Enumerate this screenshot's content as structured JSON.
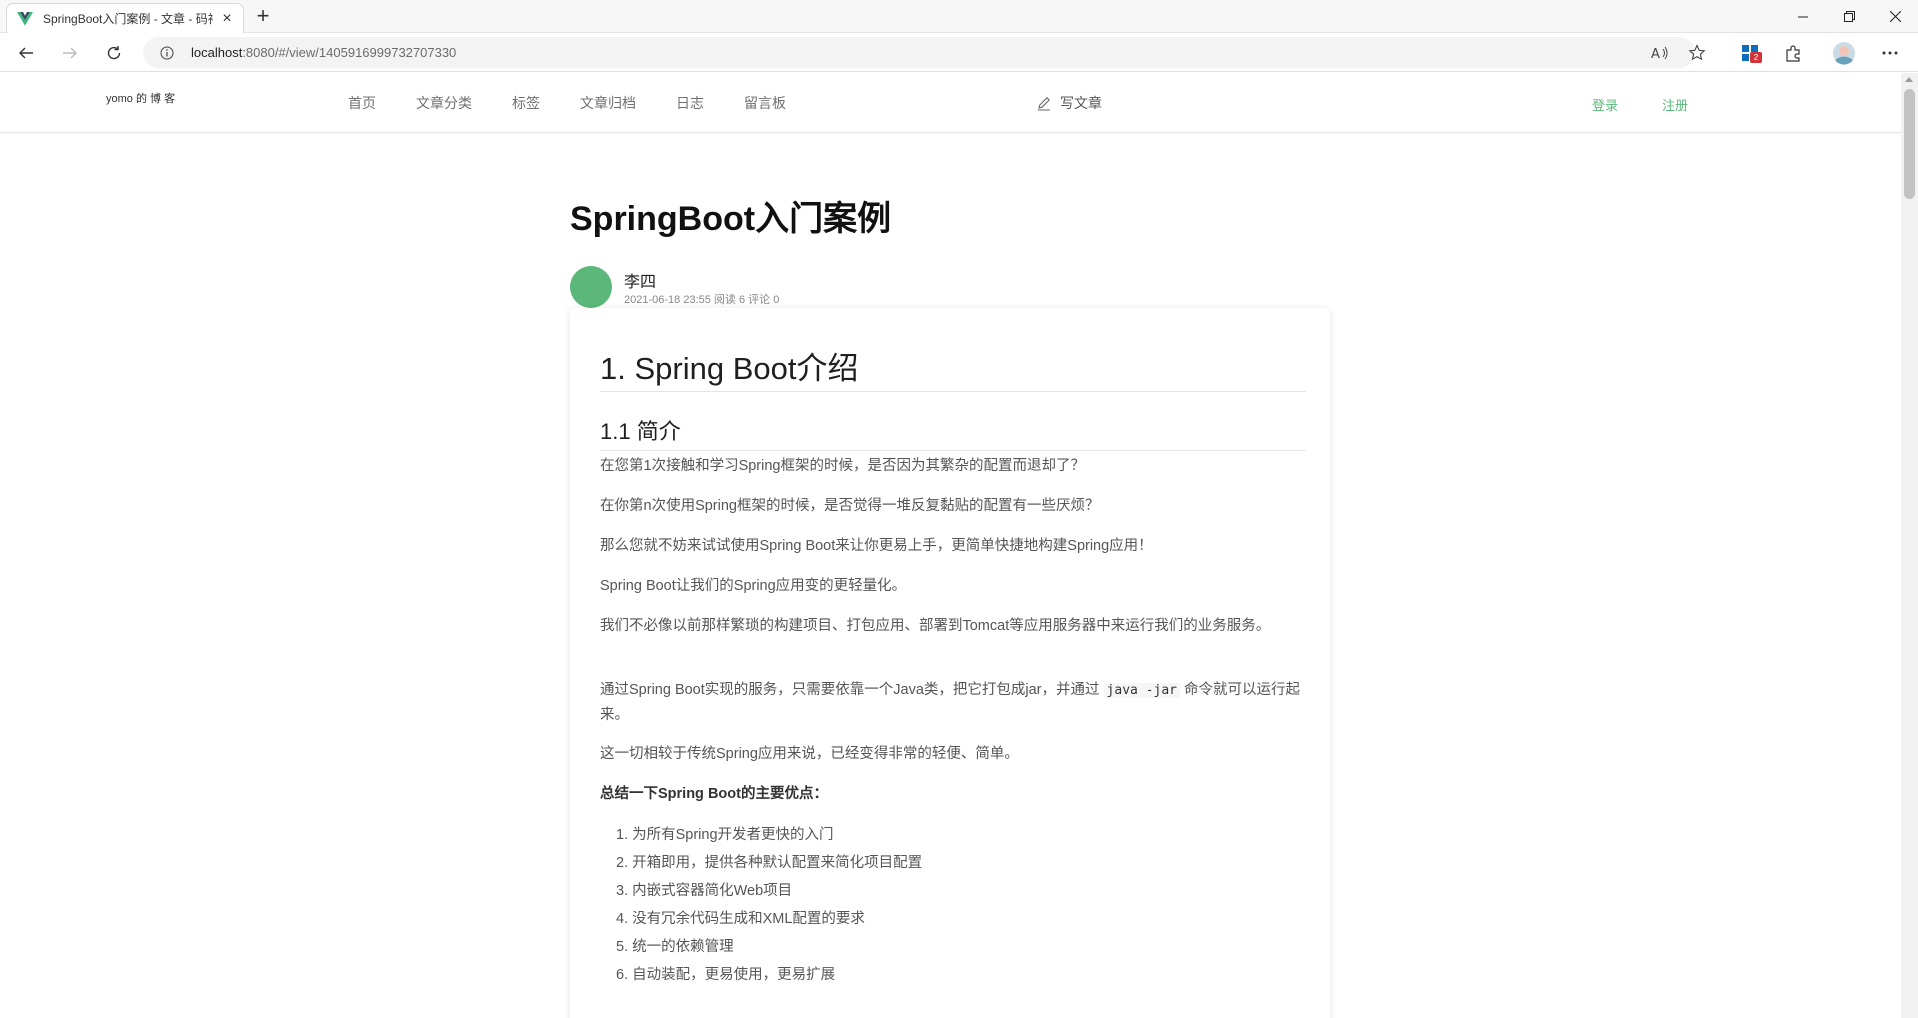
{
  "browser": {
    "tab_title": "SpringBoot入门案例 - 文章 - 码神",
    "url_host": "localhost",
    "url_rest": ":8080/#/view/1405916999732707330",
    "extension_badge": "2"
  },
  "site": {
    "logo": "yomo 的 博 客",
    "nav": [
      "首页",
      "文章分类",
      "标签",
      "文章归档",
      "日志",
      "留言板"
    ],
    "write_label": "写文章",
    "login_label": "登录",
    "register_label": "注册",
    "accent_color": "#5cb87a"
  },
  "article": {
    "title": "SpringBoot入门案例",
    "author": "李四",
    "meta": "2021-06-18 23:55 阅读 6 评论 0",
    "h1": "1. Spring Boot介绍",
    "h2": "1.1 简介",
    "p1": "在您第1次接触和学习Spring框架的时候，是否因为其繁杂的配置而退却了？",
    "p2": "在你第n次使用Spring框架的时候，是否觉得一堆反复黏贴的配置有一些厌烦？",
    "p3": "那么您就不妨来试试使用Spring Boot来让你更易上手，更简单快捷地构建Spring应用！",
    "p4": "Spring Boot让我们的Spring应用变的更轻量化。",
    "p5": "我们不必像以前那样繁琐的构建项目、打包应用、部署到Tomcat等应用服务器中来运行我们的业务服务。",
    "p6_before": "通过Spring Boot实现的服务，只需要依靠一个Java类，把它打包成jar，并通过 ",
    "p6_code": "java -jar",
    "p6_after": " 命令就可以运行起来。",
    "p7": "这一切相较于传统Spring应用来说，已经变得非常的轻便、简单。",
    "p8": "总结一下Spring Boot的主要优点：",
    "advantages": [
      "1. 为所有Spring开发者更快的入门",
      "2. 开箱即用，提供各种默认配置来简化项目配置",
      "3. 内嵌式容器简化Web项目",
      "4. 没有冗余代码生成和XML配置的要求",
      "5. 统一的依赖管理",
      "6. 自动装配，更易使用，更易扩展"
    ]
  }
}
